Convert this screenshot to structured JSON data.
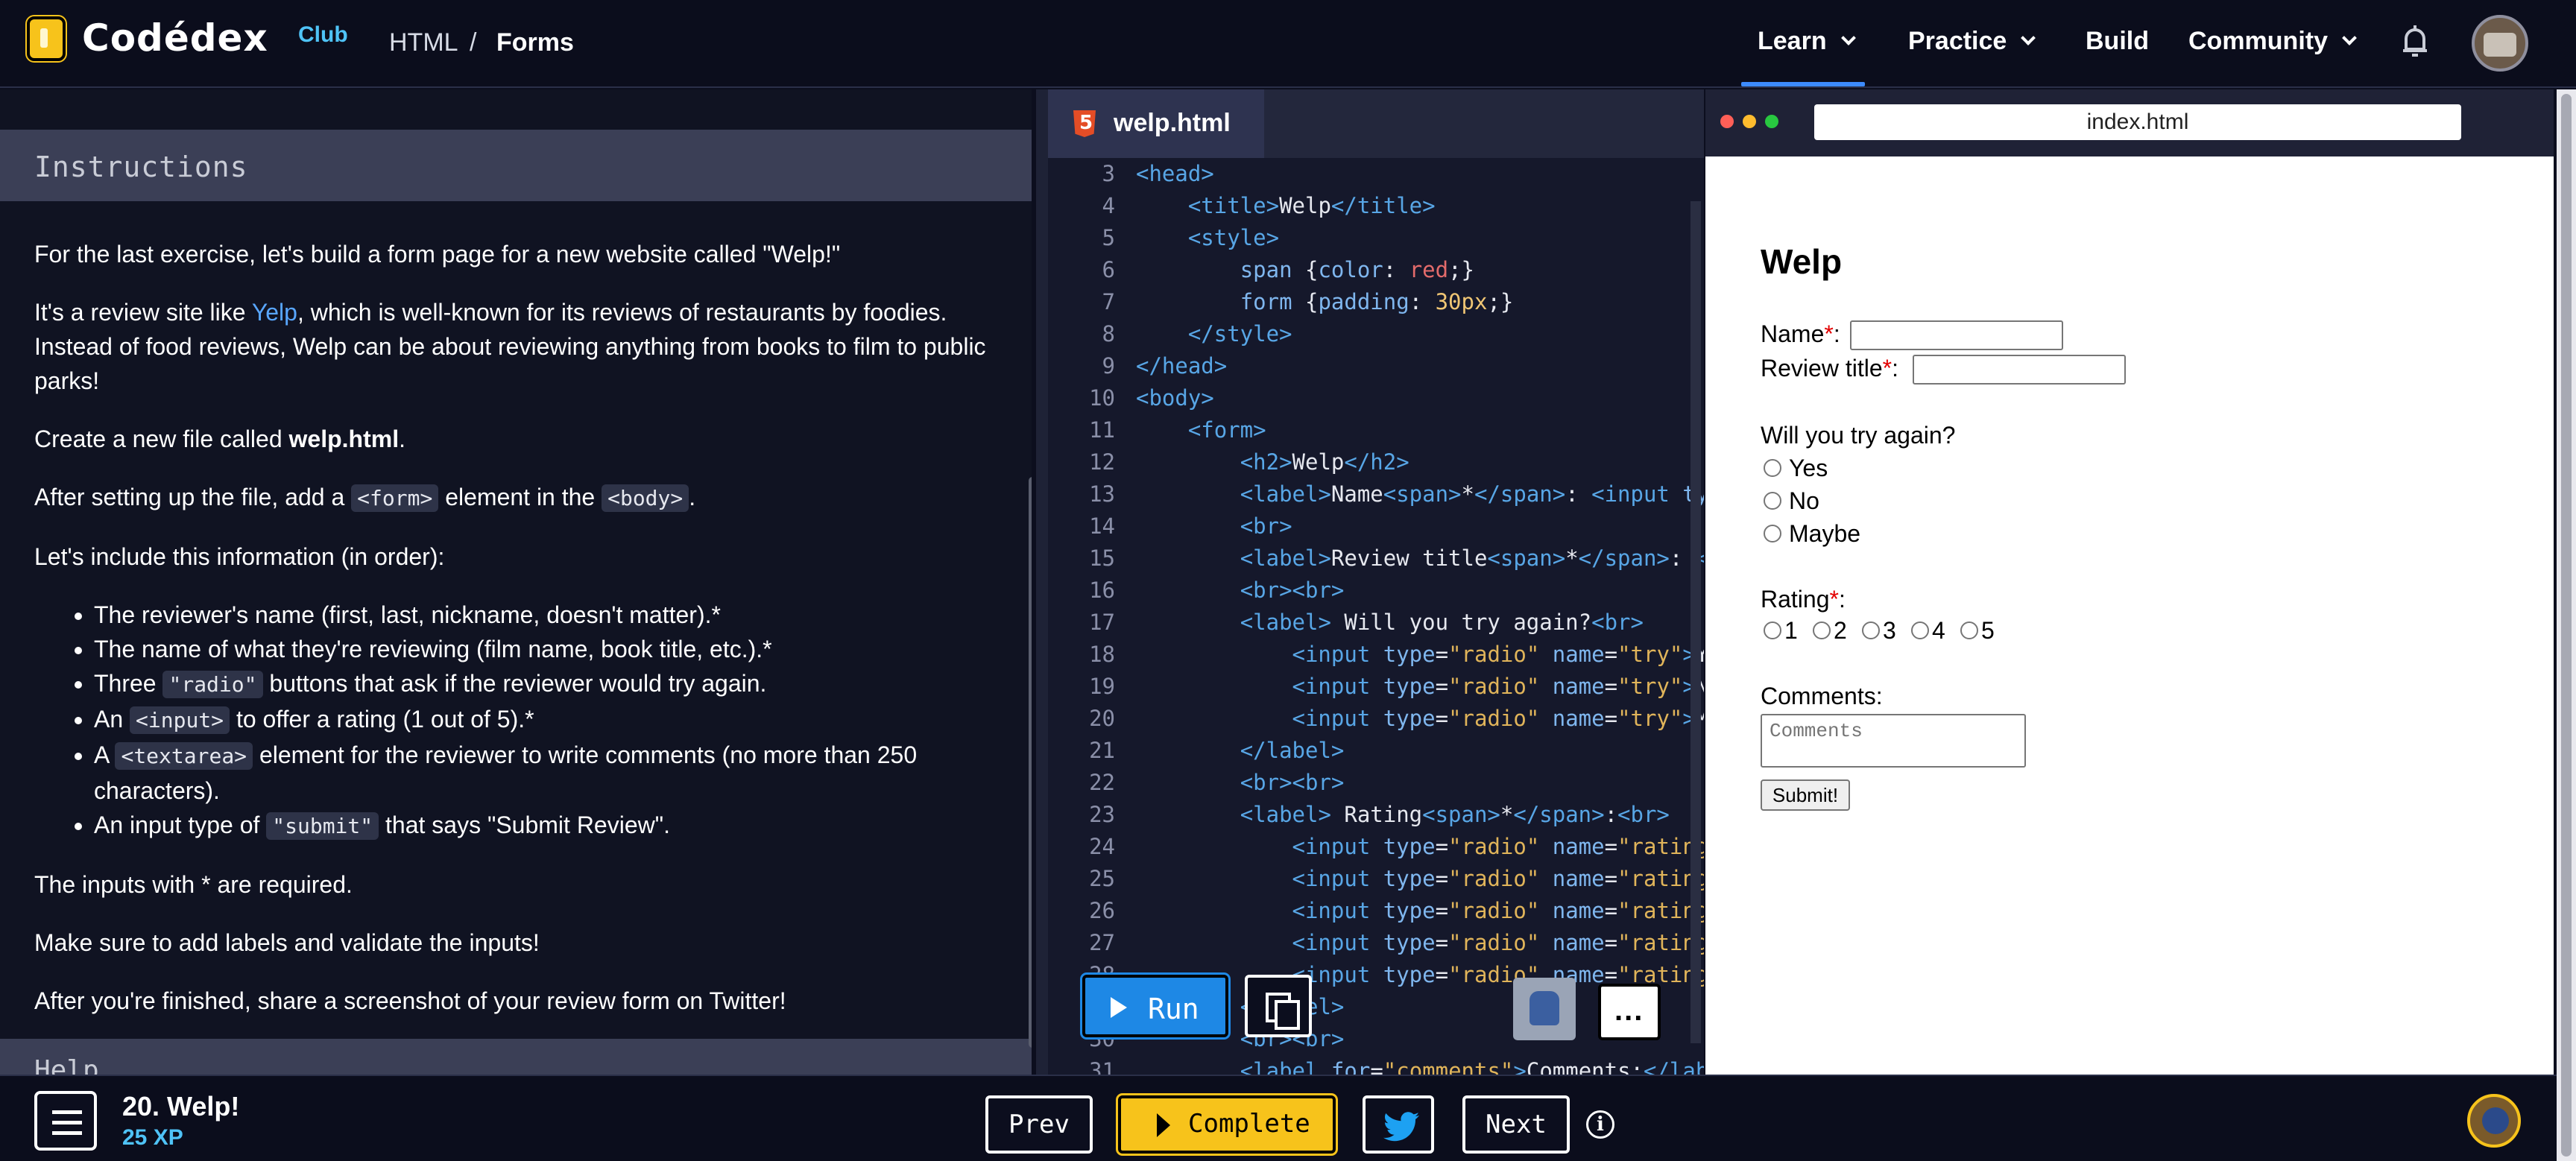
{
  "topnav": {
    "brand": "Codédex",
    "club": "Club",
    "breadcrumb": [
      "HTML",
      "/",
      "Forms"
    ],
    "nav": [
      "Learn",
      "Practice",
      "Build",
      "Community"
    ],
    "active_nav": "Learn"
  },
  "instructions": {
    "heading": "Instructions",
    "p1": "For the last exercise, let's build a form page for a new website called \"Welp!\"",
    "p2_pre": "It's a review site like ",
    "p2_link": "Yelp",
    "p2_post": ", which is well-known for its reviews of restaurants by foodies. Instead of food reviews, Welp can be about reviewing anything from books to film to public parks!",
    "p3_pre": "Create a new file called ",
    "p3_bold": "welp.html",
    "p3_post": ".",
    "p4_pre": "After setting up the file, add a ",
    "p4_code1": "<form>",
    "p4_mid": " element in the ",
    "p4_code2": "<body>",
    "p4_post": ".",
    "p5": "Let's include this information (in order):",
    "li1": "The reviewer's name (first, last, nickname, doesn't matter).*",
    "li2": "The name of what they're reviewing (film name, book title, etc.).*",
    "li3_pre": "Three ",
    "li3_code": "\"radio\"",
    "li3_post": " buttons that ask if the reviewer would try again.",
    "li4_pre": "An ",
    "li4_code": "<input>",
    "li4_post": " to offer a rating (1 out of 5).*",
    "li5_pre": "A ",
    "li5_code": "<textarea>",
    "li5_post": " element for the reviewer to write comments (no more than 250 characters).",
    "li6_pre": "An input type of ",
    "li6_code": "\"submit\"",
    "li6_post": " that says \"Submit Review\".",
    "p6": "The inputs with * are required.",
    "p7": "Make sure to add labels and validate the inputs!",
    "p8": "After you're finished, share a screenshot of your review form on Twitter!",
    "help": "Help"
  },
  "editor": {
    "filename": "welp.html",
    "run_label": "Run",
    "more_label": "..."
  },
  "preview": {
    "url": "index.html",
    "title": "Welp",
    "name_label": "Name",
    "review_label": "Review title",
    "star": "*",
    "colon": ":",
    "try_again": "Will you try again?",
    "yes": "Yes",
    "no": "No",
    "maybe": "Maybe",
    "rating": "Rating",
    "ratings": [
      "1",
      "2",
      "3",
      "4",
      "5"
    ],
    "comments": "Comments:",
    "comments_placeholder": "Comments",
    "submit": "Submit!"
  },
  "bottombar": {
    "lesson": "20. Welp!",
    "xp": "25 XP",
    "prev": "Prev",
    "complete": "Complete",
    "next": "Next",
    "info": "i"
  },
  "colors": {
    "accent_blue": "#1e88e5",
    "accent_yellow": "#f7c31b",
    "link": "#58a6ff",
    "required": "#e30000"
  }
}
